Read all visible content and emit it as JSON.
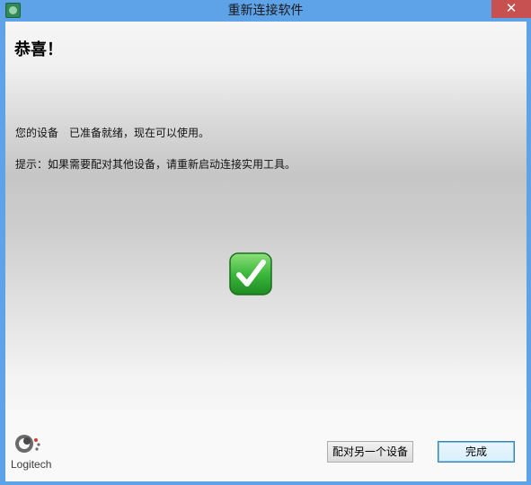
{
  "window": {
    "title": "重新连接软件",
    "close_glyph": "✕"
  },
  "main": {
    "heading": "恭喜！",
    "message_ready": "您的设备　已准备就绪，现在可以使用。",
    "message_hint": "提示：如果需要配对其他设备，请重新启动连接实用工具。",
    "status_icon": "checkmark-icon"
  },
  "footer": {
    "logo_text": "Logitech",
    "pair_button_label": "配对另一个设备",
    "finish_button_label": "完成"
  },
  "colors": {
    "titlebar": "#5ea2e8",
    "close_button": "#c75050",
    "check_green": "#3cb83c"
  }
}
